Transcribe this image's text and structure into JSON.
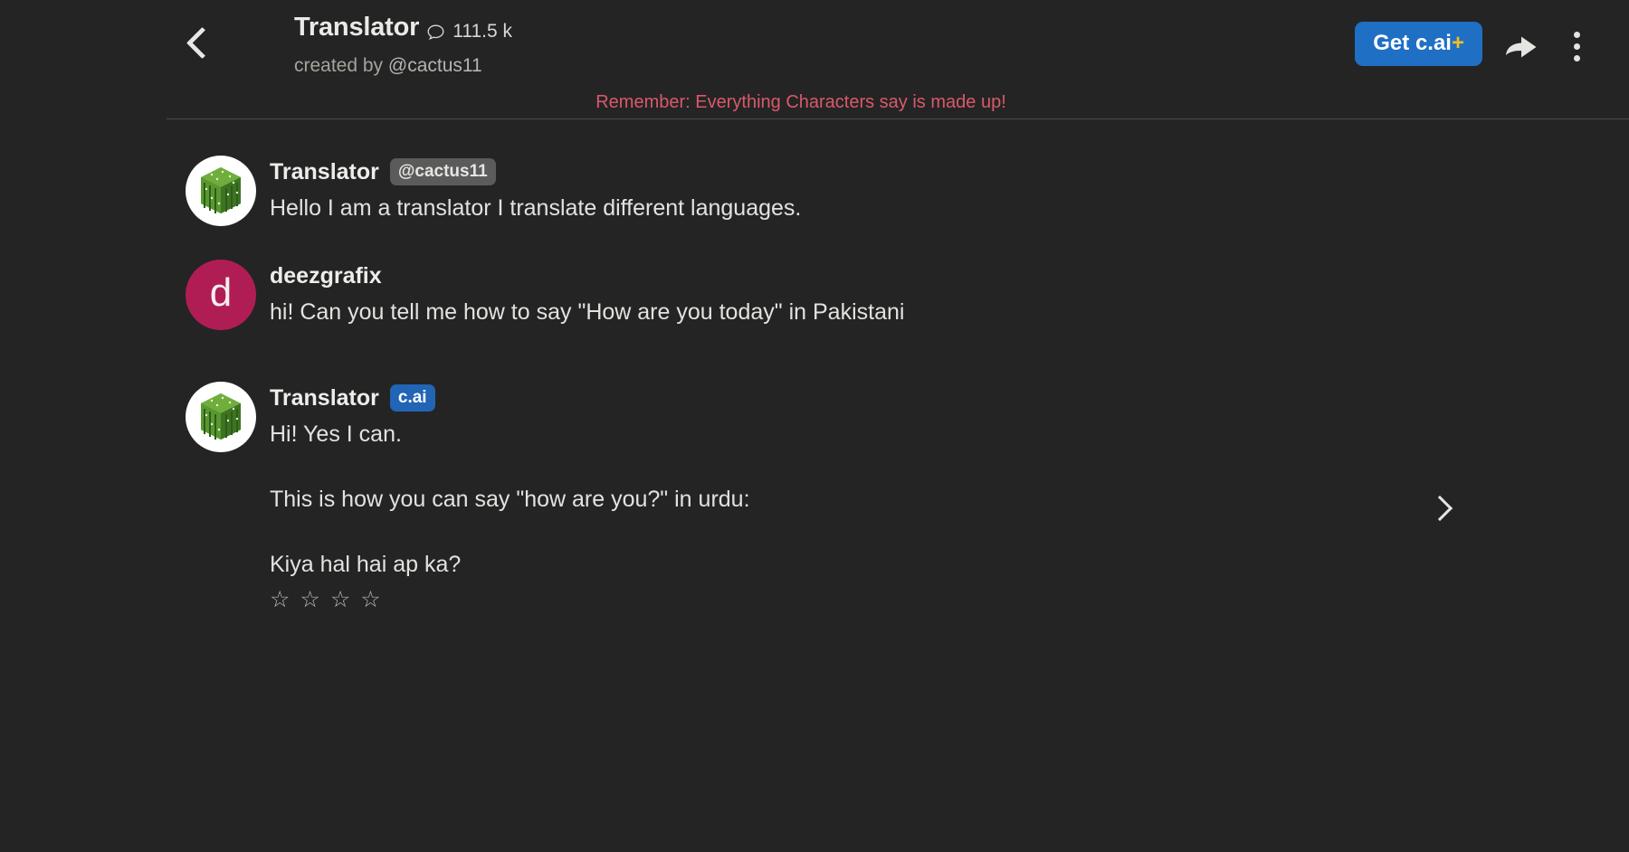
{
  "header": {
    "back_label": "back",
    "character_name": "Translator",
    "chat_count": "111.5 k",
    "created_by_prefix": "created by ",
    "creator_handle": "@cactus11",
    "cai_plus_label": "Get c.ai",
    "cai_plus_suffix": "+",
    "share_label": "share",
    "more_label": "more options"
  },
  "warning": {
    "text": "Remember: Everything Characters say is made up!",
    "color": "#d9596b"
  },
  "messages": [
    {
      "avatar_type": "cactus",
      "name": "Translator",
      "badge": "@cactus11",
      "badge_style": "gray",
      "text": "Hello I am a translator I translate different languages."
    },
    {
      "avatar_type": "letter",
      "avatar_letter": "d",
      "avatar_color": "#b01d54",
      "name": "deezgrafix",
      "badge": "",
      "badge_style": "none",
      "text": "hi! Can you tell me how to say \"How are you today\" in Pakistani"
    },
    {
      "avatar_type": "cactus",
      "name": "Translator",
      "badge": "c.ai",
      "badge_style": "blue",
      "text": "Hi! Yes I can.",
      "paragraph_2": "This is how you can say \"how are you?\" in urdu:",
      "paragraph_3": "Kiya hal hai ap ka?",
      "rating": {
        "stars": [
          "☆",
          "☆",
          "☆",
          "☆"
        ],
        "filled": 0
      }
    }
  ],
  "next_swipe_label": "next response",
  "theme": {
    "background": "#242424",
    "accent_blue": "#1f6fc4",
    "badge_blue": "#2264b5",
    "text_primary": "#e8e6e3",
    "text_muted": "#a6a39e"
  }
}
